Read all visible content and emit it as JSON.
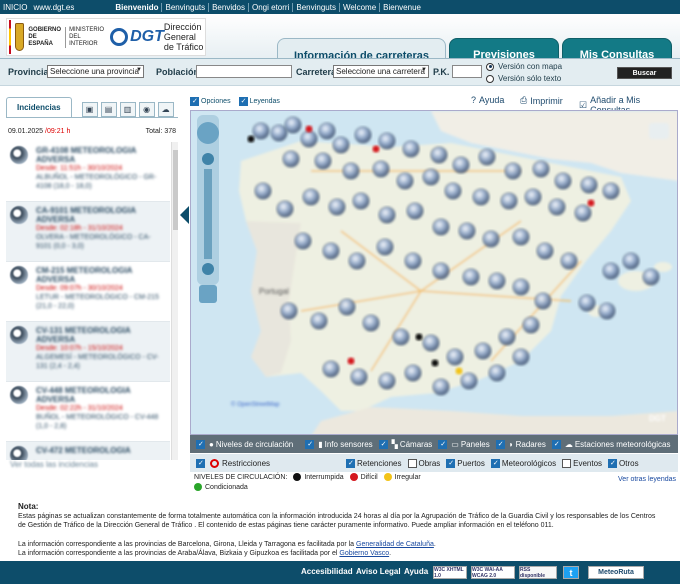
{
  "topbar": {
    "inicio": "INICIO",
    "url": "www.dgt.es",
    "langs": [
      "Bienvenido",
      "Benvinguts",
      "Benvidos",
      "Ongi etorri",
      "Benvinguts",
      "Welcome",
      "Bienvenue"
    ]
  },
  "header": {
    "gobierno": "GOBIERNO DE ESPAÑA",
    "ministerio": "MINISTERIO DEL INTERIOR",
    "dgt": "DGT",
    "dgt_sub": "Dirección General de Tráfico",
    "tabs": [
      "Información de carreteras",
      "Previsiones",
      "Mis Consultas"
    ]
  },
  "search": {
    "provincia_label": "Provincia",
    "provincia_value": "Seleccione una provincia",
    "poblacion_label": "Población",
    "carretera_label": "Carretera",
    "carretera_value": "Seleccione una carretera",
    "pk_label": "P.K.",
    "radio_mapa": "Versión con mapa",
    "radio_texto": "Versión sólo texto",
    "buscar": "Buscar"
  },
  "left": {
    "tab_label": "Incidencias",
    "date": "09.01.2025",
    "hour": "/09:21 h",
    "total": "Total: 378",
    "items": [
      {
        "title": "GR-4108 METEOROLOGIA ADVERSA",
        "line1": "Desde: 11:51h - 30/10/2024",
        "line2": "ALBUÑOL - METEOROLÓGICO - GR-4108 (18,0 - 18,0)"
      },
      {
        "title": "CA-9101 METEOROLOGIA ADVERSA",
        "line1": "Desde: 02:18h - 31/10/2024",
        "line2": "OLVERA - METEOROLÓGICO - CA-9101 (0,0 - 3,0)"
      },
      {
        "title": "CM-215 METEOROLOGIA ADVERSA",
        "line1": "Desde: 09:07h - 30/10/2024",
        "line2": "LETUR - METEOROLÓGICO - CM-215 (21,0 - 22,0)"
      },
      {
        "title": "CV-131 METEOROLOGIA ADVERSA",
        "line1": "Desde: 10:07h - 15/10/2024",
        "line2": "ALGEMESÍ - METEOROLÓGICO - CV-131 (2,4 - 2,4)"
      },
      {
        "title": "CV-448 METEOROLOGIA ADVERSA",
        "line1": "Desde: 02:22h - 31/10/2024",
        "line2": "BUÑOL - METEOROLÓGICO - CV-448 (1,0 - 2,8)"
      },
      {
        "title": "CV-472 METEOROLOGIA",
        "line1": "",
        "line2": ""
      }
    ],
    "all_link": "Ver todas las incidencias"
  },
  "mapbar": {
    "opciones": "Opciones",
    "leyendas": "Leyendas",
    "ayuda": "Ayuda",
    "imprimir": "Imprimir",
    "anadir": "Añadir a Mis Consultas"
  },
  "map": {
    "portugal": "Portugal",
    "copyright": "© OpenStreetMap",
    "logo": "DGT"
  },
  "legend1": [
    "Niveles de circulación",
    "Info sensores",
    "Cámaras",
    "Paneles",
    "Radares",
    "Estaciones meteorológicas"
  ],
  "legend2": {
    "restricciones": "Restricciones",
    "items": [
      {
        "label": "Retenciones",
        "checked": true
      },
      {
        "label": "Obras",
        "checked": false
      },
      {
        "label": "Puertos",
        "checked": true
      },
      {
        "label": "Meteorológicos",
        "checked": true
      },
      {
        "label": "Eventos",
        "checked": false
      },
      {
        "label": "Otros",
        "checked": true
      }
    ]
  },
  "levels": {
    "title": "NIVELES DE CIRCULACIÓN:",
    "items": [
      {
        "label": "Interrumpida",
        "color": "#111111"
      },
      {
        "label": "Difícil",
        "color": "#d4171e"
      },
      {
        "label": "Irregular",
        "color": "#f2c318"
      },
      {
        "label": "Condicionada",
        "color": "#2aa52a"
      }
    ],
    "more": "Ver otras leyendas"
  },
  "nota": {
    "title": "Nota:",
    "p1": "Estas páginas se actualizan constantemente de forma totalmente automática con la información introducida 24 horas al día por la Agrupación de Tráfico de la Guardia Civil y los responsables de los Centros de Gestión de Tráfico de la Dirección General de Tráfico . El contenido de estas páginas tiene carácter puramente informativo. Puede ampliar información en el teléfono 011.",
    "p2a": "La información correspondiente a las provincias de Barcelona, Girona, Lleida y Tarragona es facilitada por la",
    "p2link": "Generalidad de Cataluña",
    "p3a": "La información correspondiente a las provincias de Araba/Álava, Bizkaia y Gipuzkoa es facilitada por el",
    "p3link": "Gobierno Vasco"
  },
  "footer": {
    "accesibilidad": "Accesibilidad",
    "aviso": "Aviso Legal",
    "ayuda": "Ayuda",
    "w3c1": "W3C XHTML 1.0",
    "w3c2": "W3C WAI-AA WCAG 2.0",
    "rss": "RSS disponible",
    "meteoruta": "MeteoRuta"
  }
}
